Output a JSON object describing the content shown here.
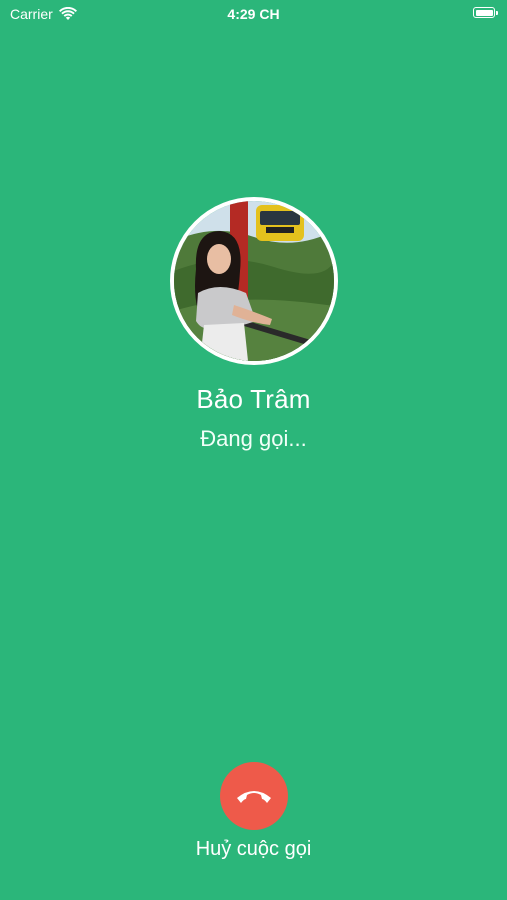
{
  "status_bar": {
    "carrier": "Carrier",
    "time": "4:29 CH",
    "icons": [
      "wifi-icon",
      "battery-icon"
    ]
  },
  "caller": {
    "name": "Bảo Trâm",
    "status": "Đang gọi..."
  },
  "actions": {
    "hangup_label": "Huỷ cuộc gọi",
    "hangup_icon": "phone-hangup-icon"
  },
  "colors": {
    "background": "#2bb67a",
    "hangup_button": "#ee5a4a",
    "text": "#ffffff"
  }
}
